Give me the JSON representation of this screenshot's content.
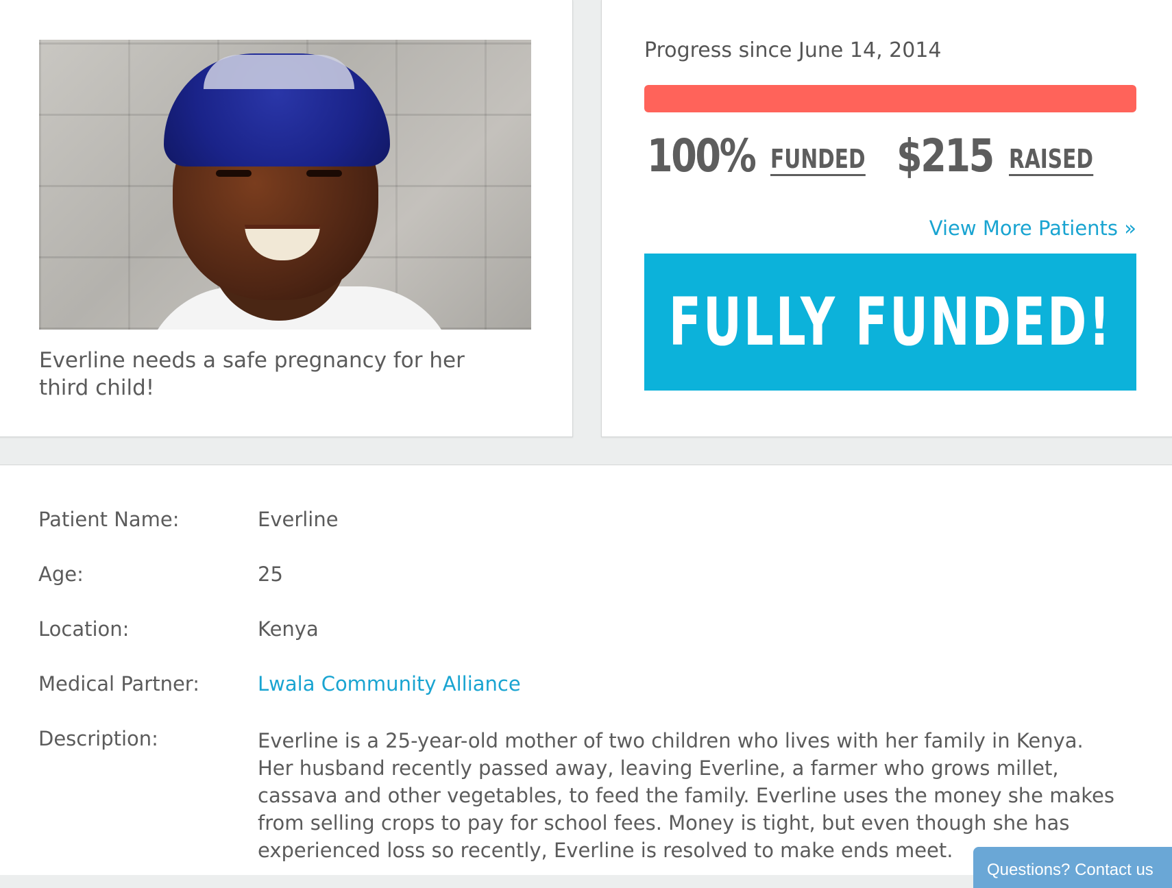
{
  "patient": {
    "caption": "Everline needs a safe pregnancy for her third child!"
  },
  "progress": {
    "label": "Progress since June 14, 2014",
    "percent_funded": 1.0,
    "percent_text": "100%",
    "funded_label": "FUNDED",
    "amount_text": "$215",
    "raised_label": "RAISED",
    "view_more": "View More Patients  »",
    "banner": "FULLY FUNDED!",
    "bar_color": "#ff635a",
    "banner_color": "#0cb2da"
  },
  "details": {
    "name_label": "Patient Name:",
    "name_value": "Everline",
    "age_label": "Age:",
    "age_value": "25",
    "location_label": "Location:",
    "location_value": "Kenya",
    "partner_label": "Medical Partner:",
    "partner_value": "Lwala Community Alliance",
    "description_label": "Description:",
    "description_value": "Everline is a 25-year-old mother of two children who lives with her family in Kenya. Her husband recently passed away, leaving Everline, a farmer who grows millet, cassava and other vegetables, to feed the family. Everline uses the money she makes from selling crops to pay for school fees. Money is tight, but even though she has experienced loss so recently, Everline is resolved to make ends meet."
  },
  "contact_tab": "Questions? Contact us",
  "link_color": "#19a4d1"
}
